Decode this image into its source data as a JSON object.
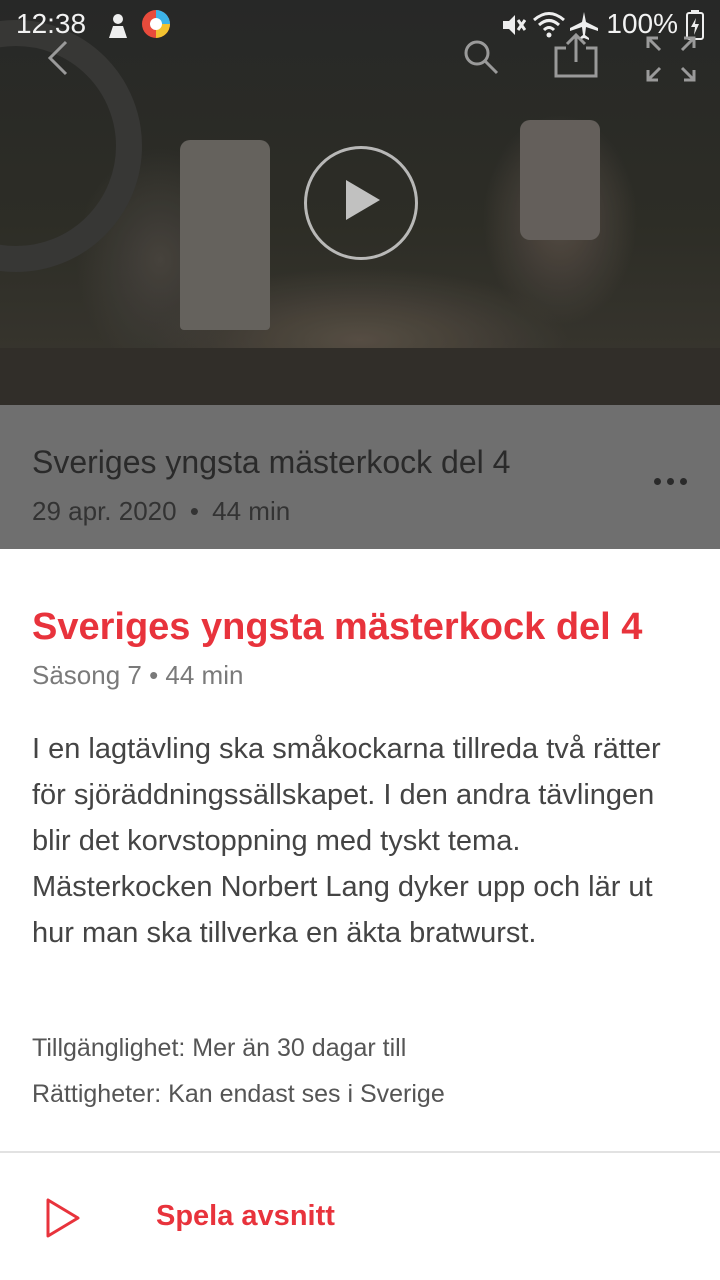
{
  "status_bar": {
    "time": "12:38",
    "battery": "100%"
  },
  "hero": {
    "title": "Sveriges yngsta mästerkock del 4",
    "meta_date": "29 apr. 2020",
    "meta_separator": "•",
    "meta_duration": "44 min"
  },
  "toolbar": {
    "icons": [
      "back-icon",
      "search-icon",
      "share-icon",
      "fullscreen-icon"
    ]
  },
  "episode": {
    "title": "Sveriges yngsta mästerkock del 4",
    "subtitle": "Säsong 7 • 44 min",
    "description": "I en lagtävling ska småkockarna tillreda två rätter för sjöräddningssällskapet. I den andra tävlingen blir det korvstoppning med tyskt tema. Mästerkocken Norbert Lang dyker upp och lär ut hur man ska tillverka en äkta bratwurst.",
    "availability": "Tillgänglighet: Mer än 30 dagar till",
    "rights": "Rättigheter: Kan endast ses i Sverige",
    "play_label": "Spela avsnitt"
  },
  "colors": {
    "accent": "#e8333c",
    "overlay": "#6f6f6f"
  }
}
